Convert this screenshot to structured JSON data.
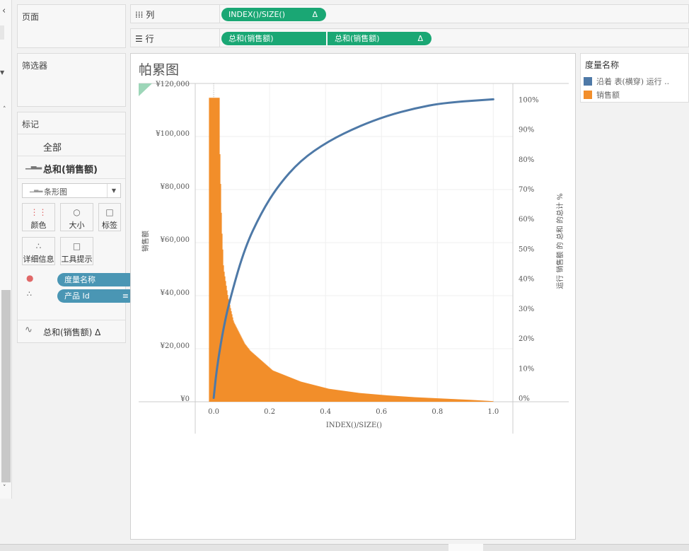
{
  "shelves": {
    "pages_label": "页面",
    "filters_label": "筛选器",
    "columns": {
      "label": "列",
      "icon": "columns-icon",
      "pills": [
        {
          "text": "INDEX()/SIZE()",
          "delta": "Δ"
        }
      ]
    },
    "rows": {
      "label": "行",
      "icon": "rows-icon",
      "pills": [
        {
          "text": "总和(销售额)",
          "delta": ""
        },
        {
          "text": "总和(销售额)",
          "delta": "Δ"
        }
      ]
    }
  },
  "marks": {
    "title": "标记",
    "all": "全部",
    "layer1": "总和(销售额)",
    "mark_type": "条形图",
    "buttons": {
      "color": "颜色",
      "size": "大小",
      "label": "标签",
      "detail": "详细信息",
      "tooltip": "工具提示"
    },
    "fields": [
      {
        "text": "度量名称",
        "icon": "color-icon"
      },
      {
        "text": "产品 Id",
        "icon": "detail-icon"
      }
    ],
    "layer2": "总和(销售额) Δ"
  },
  "legend": {
    "title": "度量名称",
    "items": [
      {
        "label": "沿着 表(横穿) 运行 ..",
        "color": "#4e79a7"
      },
      {
        "label": "销售额",
        "color": "#f28e2b"
      }
    ]
  },
  "chart_data": {
    "type": "bar+line",
    "title": "帕累图",
    "xlabel": "INDEX()/SIZE()",
    "ylabel": "销售额",
    "y2label": "运行 销售额 的 总和 的总计 %",
    "xlim": [
      -0.066,
      1.07
    ],
    "ylim": [
      0,
      120000
    ],
    "y2lim": [
      -1.3,
      105.3
    ],
    "xticks": [
      "0.0",
      "0.2",
      "0.4",
      "0.6",
      "0.8",
      "1.0"
    ],
    "yticks": [
      "¥0",
      "¥20,000",
      "¥40,000",
      "¥60,000",
      "¥80,000",
      "¥100,000",
      "¥120,000"
    ],
    "y2ticks": [
      "0%",
      "10%",
      "20%",
      "30%",
      "40%",
      "50%",
      "60%",
      "70%",
      "80%",
      "90%",
      "100%"
    ],
    "bars": {
      "name": "销售额",
      "color": "#f28e2b",
      "x": [
        -0.017,
        0.019,
        0.021,
        0.027,
        0.034,
        0.05,
        0.07,
        0.11,
        0.13,
        0.21,
        0.31,
        0.41,
        0.52,
        0.62,
        0.72,
        0.82,
        0.92,
        1.0
      ],
      "y": [
        114600,
        114600,
        92800,
        67000,
        50500,
        39400,
        30200,
        21900,
        19200,
        11800,
        7600,
        4900,
        3300,
        2400,
        1700,
        1200,
        700,
        200
      ]
    },
    "line": {
      "name": "沿着 表(横穿) 运行 ..",
      "color": "#4e79a7",
      "x": [
        0,
        0.01,
        0.03,
        0.055,
        0.11,
        0.17,
        0.23,
        0.31,
        0.41,
        0.52,
        0.62,
        0.72,
        0.82,
        1.0
      ],
      "y": [
        0,
        9,
        21,
        32,
        50,
        62,
        71,
        79.5,
        86,
        91,
        94.5,
        97,
        98.8,
        100
      ]
    },
    "grid": true
  }
}
